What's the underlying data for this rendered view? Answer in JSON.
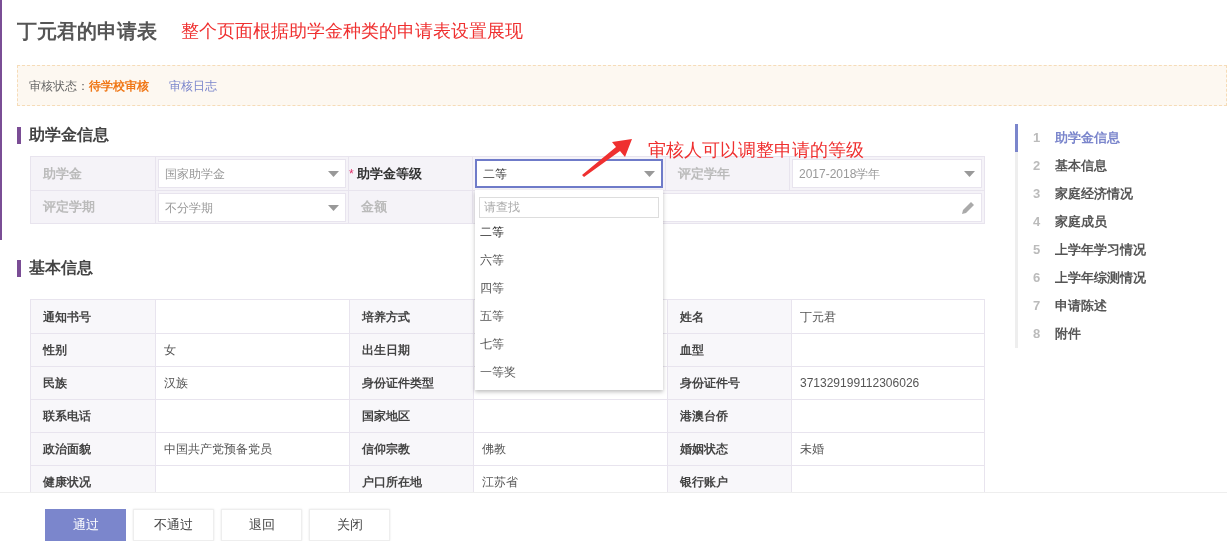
{
  "title": "丁元君的申请表",
  "annotations": [
    {
      "text": "整个页面根据助学金种类的申请表设置展现",
      "arrow": false
    },
    {
      "text": "审核人可以调整申请的等级",
      "arrow": true
    }
  ],
  "status": {
    "label": "审核状态：",
    "value": "待学校审核",
    "link": "审核日志"
  },
  "sections": [
    {
      "title": "助学金信息"
    },
    {
      "title": "基本信息"
    }
  ],
  "scholarship_form": {
    "rows": [
      [
        {
          "label": "助学金",
          "disabled": true,
          "kind": "select",
          "value": "国家助学金",
          "open": false
        },
        {
          "required_mark": "*",
          "label": "助学金等级",
          "disabled": false,
          "kind": "select",
          "value": "二等",
          "open": true
        },
        {
          "label": "评定学年",
          "disabled": true,
          "kind": "select",
          "value": "2017-2018学年",
          "open": false
        }
      ],
      [
        {
          "label": "评定学期",
          "disabled": true,
          "kind": "select",
          "value": "不分学期",
          "open": false
        },
        {
          "label": "金额",
          "disabled": true,
          "kind": "text"
        }
      ]
    ]
  },
  "dropdown": {
    "placeholder": "请查找",
    "options": [
      {
        "label": "二等",
        "selected": true
      },
      {
        "label": "六等",
        "selected": false
      },
      {
        "label": "四等",
        "selected": false
      },
      {
        "label": "五等",
        "selected": false
      },
      {
        "label": "七等",
        "selected": false
      },
      {
        "label": "一等奖",
        "selected": false
      }
    ]
  },
  "basic_info": {
    "rows": [
      [
        {
          "label": "通知书号"
        },
        {
          "label": "培养方式"
        },
        {
          "label": "姓名",
          "value": "丁元君"
        }
      ],
      [
        {
          "label": "性别",
          "value": "女"
        },
        {
          "label": "出生日期"
        },
        {
          "label": "血型"
        }
      ],
      [
        {
          "label": "民族",
          "value": "汉族"
        },
        {
          "label": "身份证件类型"
        },
        {
          "label": "身份证件号",
          "value": "371329199112306026"
        }
      ],
      [
        {
          "label": "联系电话"
        },
        {
          "label": "国家地区"
        },
        {
          "label": "港澳台侨"
        }
      ],
      [
        {
          "label": "政治面貌",
          "value": "中国共产党预备党员"
        },
        {
          "label": "信仰宗教",
          "value": "佛教"
        },
        {
          "label": "婚姻状态",
          "value": "未婚"
        }
      ],
      [
        {
          "label": "健康状况"
        },
        {
          "label": "户口所在地",
          "value": "江苏省"
        },
        {
          "label": "银行账户"
        }
      ]
    ]
  },
  "nav": [
    {
      "number": "1",
      "label": "助学金信息",
      "selected": true
    },
    {
      "number": "2",
      "label": "基本信息",
      "selected": false
    },
    {
      "number": "3",
      "label": "家庭经济情况",
      "selected": false
    },
    {
      "number": "4",
      "label": "家庭成员",
      "selected": false
    },
    {
      "number": "5",
      "label": "上学年学习情况",
      "selected": false
    },
    {
      "number": "6",
      "label": "上学年综测情况",
      "selected": false
    },
    {
      "number": "7",
      "label": "申请陈述",
      "selected": false
    },
    {
      "number": "8",
      "label": "附件",
      "selected": false
    }
  ],
  "buttons": [
    {
      "label": "通过",
      "primary": true
    },
    {
      "label": "不通过",
      "primary": false
    },
    {
      "label": "退回",
      "primary": false
    },
    {
      "label": "关闭",
      "primary": false
    }
  ]
}
